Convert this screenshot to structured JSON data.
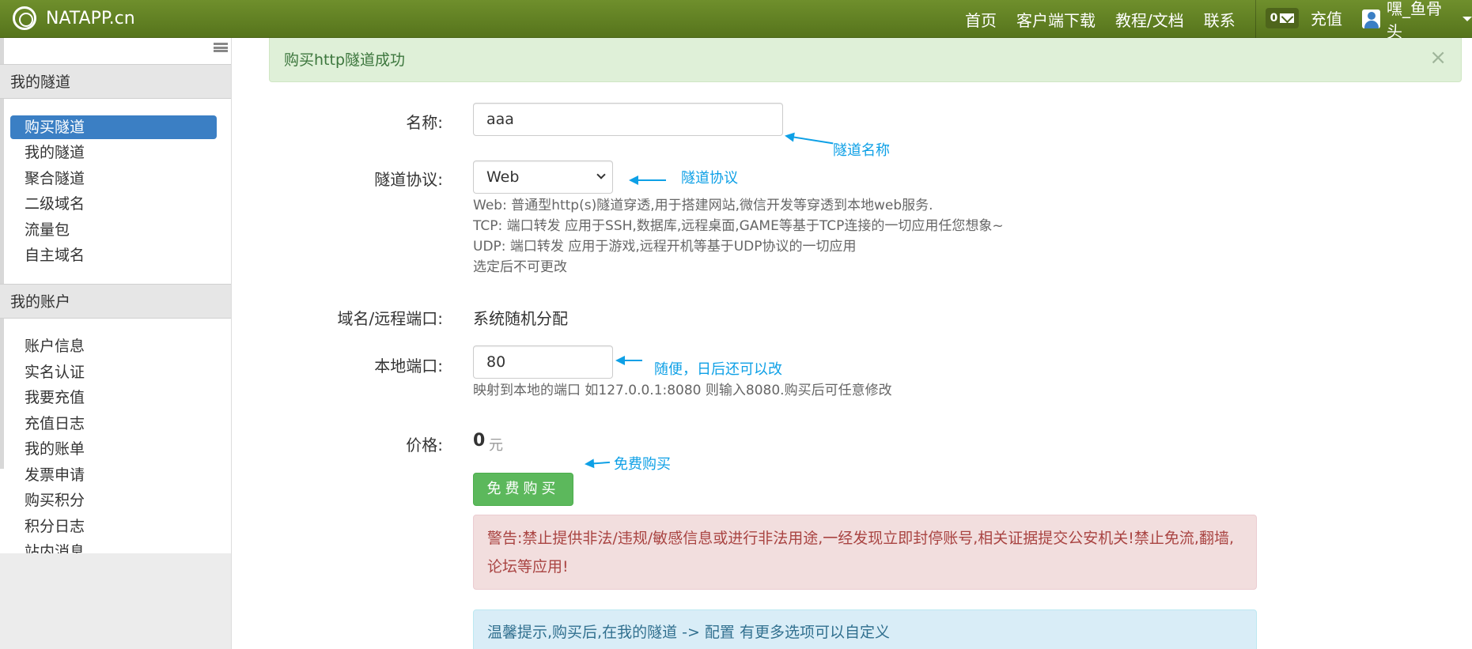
{
  "navbar": {
    "brand": "NATAPP.cn",
    "links": [
      "首页",
      "客户端下载",
      "教程/文档",
      "联系"
    ],
    "message_count": "0",
    "recharge": "充值",
    "username": "嘿_鱼骨头"
  },
  "sidebar": {
    "section1_title": "我的隧道",
    "section1_items": [
      "购买隧道",
      "我的隧道",
      "聚合隧道",
      "二级域名",
      "流量包",
      "自主域名"
    ],
    "section2_title": "我的账户",
    "section2_items": [
      "账户信息",
      "实名认证",
      "我要充值",
      "充值日志",
      "我的账单",
      "发票申请",
      "购买积分",
      "积分日志",
      "站内消息"
    ]
  },
  "success_alert": "购买http隧道成功",
  "form": {
    "name_label": "名称:",
    "name_value": "aaa",
    "protocol_label": "隧道协议:",
    "protocol_value": "Web",
    "protocol_help": [
      "Web: 普通型http(s)隧道穿透,用于搭建网站,微信开发等穿透到本地web服务.",
      "TCP: 端口转发 应用于SSH,数据库,远程桌面,GAME等基于TCP连接的一切应用任您想象~",
      "UDP: 端口转发 应用于游戏,远程开机等基于UDP协议的一切应用",
      "选定后不可更改"
    ],
    "domain_label": "域名/远程端口:",
    "domain_value": "系统随机分配",
    "port_label": "本地端口:",
    "port_value": "80",
    "port_help": "映射到本地的端口 如127.0.0.1:8080 则输入8080.购买后可任意修改",
    "price_label": "价格:",
    "price_value": "0",
    "price_unit": "元",
    "submit": "免费购买"
  },
  "annotations": {
    "name": "隧道名称",
    "protocol": "隧道协议",
    "port": "随便，日后还可以改",
    "buy": "免费购买"
  },
  "warning": "警告:禁止提供非法/违规/敏感信息或进行非法用途,一经发现立即封停账号,相关证据提交公安机关!禁止免流,翻墙,论坛等应用!",
  "tip": "温馨提示,购买后,在我的隧道 -> 配置 有更多选项可以自定义",
  "colors": {
    "navbar": "#6f8f2c",
    "active": "#3b7fc4",
    "annotation": "#0ea0e6",
    "success_btn": "#5cb85c"
  }
}
